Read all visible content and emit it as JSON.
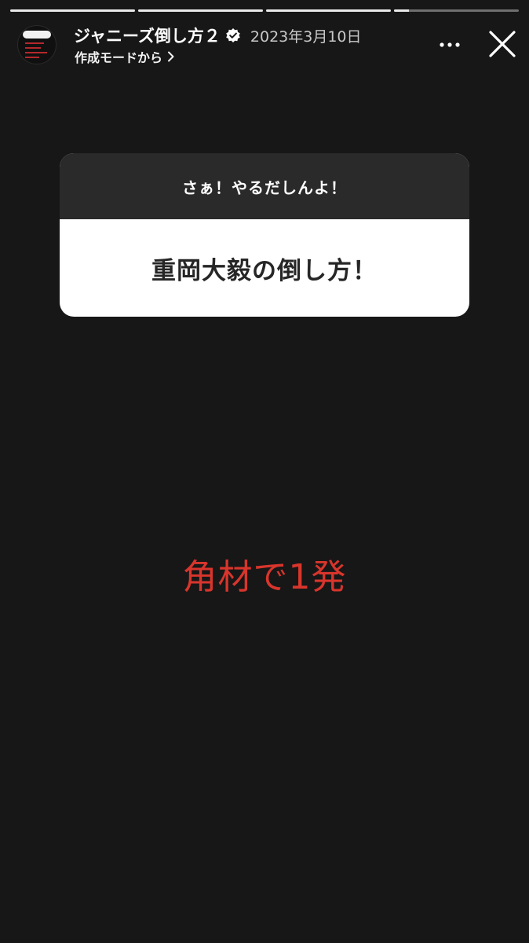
{
  "progress": {
    "segments": [
      1,
      1,
      1,
      0.12
    ]
  },
  "header": {
    "username": "ジャニーズ倒し方２",
    "date": "2023年3月10日",
    "subtitle": "作成モードから",
    "icons": {
      "verified": "verified-badge-icon",
      "chevron": "chevron-right-icon",
      "more": "more-options-icon",
      "close": "close-icon"
    }
  },
  "question_card": {
    "prompt": "さぁ！やるだしんよ！",
    "answer": "重岡大毅の倒し方！"
  },
  "reply_text": "角材で1発",
  "colors": {
    "background": "#171717",
    "card_header": "#2a2a2a",
    "card_body": "#ffffff",
    "reply_text": "#d8352c"
  }
}
